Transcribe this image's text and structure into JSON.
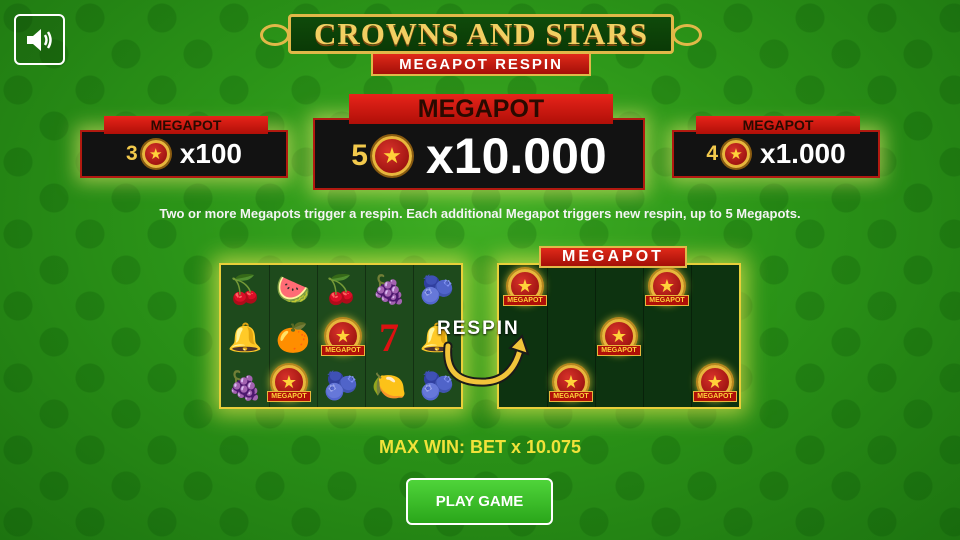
{
  "logo": {
    "title": "CROWNS AND STARS",
    "subtitle": "MEGAPOT RESPIN"
  },
  "sound": {
    "icon": "speaker-icon"
  },
  "megapots": [
    {
      "label": "MEGAPOT",
      "count": "3",
      "multiplier": "x100"
    },
    {
      "label": "MEGAPOT",
      "count": "5",
      "multiplier": "x10.000"
    },
    {
      "label": "MEGAPOT",
      "count": "4",
      "multiplier": "x1.000"
    }
  ],
  "description": "Two or more Megapots trigger a respin. Each additional Megapot triggers new respin, up to 5 Megapots.",
  "example": {
    "respin_label": "RESPIN",
    "right_banner": "MEGAPOT",
    "coin_text": "MEGAPOT"
  },
  "max_win": "MAX WIN: BET x 10.075",
  "play_button": "PLAY GAME",
  "colors": {
    "background": "#2b9418",
    "gold": "#e1b848",
    "red": "#b00f08",
    "max_win": "#f1e23a",
    "play_button": "#2aa61a"
  }
}
